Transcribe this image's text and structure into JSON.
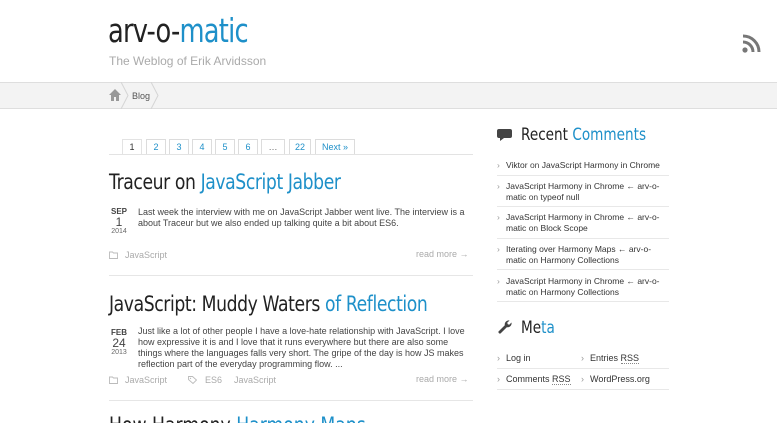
{
  "site": {
    "title_part1": "arv-o-",
    "title_part2": "matic",
    "tagline": "The Weblog of Erik Arvidsson"
  },
  "breadcrumb": {
    "current": "Blog"
  },
  "pager": {
    "pages": [
      "1",
      "2",
      "3",
      "4",
      "5",
      "6",
      "…",
      "22"
    ],
    "next": "Next »",
    "current": "1"
  },
  "posts": [
    {
      "title_part1": "Traceur on ",
      "title_part2": "JavaScript Jabber",
      "month": "SEP",
      "day": "1",
      "year": "2014",
      "excerpt": "Last week the interview with me on JavaScript Jabber went live. The interview is a about Traceur but we also ended up talking quite a bit about ES6.",
      "categories": [
        "JavaScript"
      ],
      "tags": [],
      "more": "read more →"
    },
    {
      "title_part1": "JavaScript: Muddy Waters ",
      "title_part2": "of Reflection",
      "month": "FEB",
      "day": "24",
      "year": "2013",
      "excerpt": "Just like a lot of other people I have a love-hate relationship with JavaScript. I love how expressive it is and I love that it runs everywhere but there are also some things where the languages falls very short. The gripe of the day is how JS makes reflection part of the everyday programming flow. ...",
      "categories": [
        "JavaScript"
      ],
      "tags": [
        "ES6",
        "JavaScript"
      ],
      "more": "read more →"
    }
  ],
  "next_post_partial": {
    "title_part1": "How Harmony ",
    "title_part2": "Harmony Maps"
  },
  "sidebar": {
    "recent_comments": {
      "heading_part1": "Recent ",
      "heading_part2": "Comments",
      "on_word": "on",
      "items": [
        {
          "author": "Viktor",
          "post": "JavaScript Harmony in Chrome"
        },
        {
          "author": "JavaScript Harmony in Chrome ← arv-o-matic",
          "post": "typeof null"
        },
        {
          "author": "JavaScript Harmony in Chrome ← arv-o-matic",
          "post": "Block Scope"
        },
        {
          "author": "Iterating over Harmony Maps ← arv-o-matic",
          "post": "Harmony Collections"
        },
        {
          "author": "JavaScript Harmony in Chrome ← arv-o-matic",
          "post": "Harmony Collections"
        }
      ]
    },
    "meta": {
      "heading_part1": "Me",
      "heading_part2": "ta",
      "login": "Log in",
      "entries_rss_word": "Entries ",
      "comments_rss_word": "Comments ",
      "rss_abbr": "RSS",
      "wordpress": "WordPress.org"
    }
  },
  "colors": {
    "accent": "#1e90c9",
    "text": "#333333",
    "muted": "#aaaaaa",
    "breadcrumb_bg": "#f3f3f3"
  },
  "icons": [
    "rss-icon",
    "home-icon",
    "folder-icon",
    "tag-icon",
    "comment-bubble-icon",
    "wrench-icon"
  ]
}
